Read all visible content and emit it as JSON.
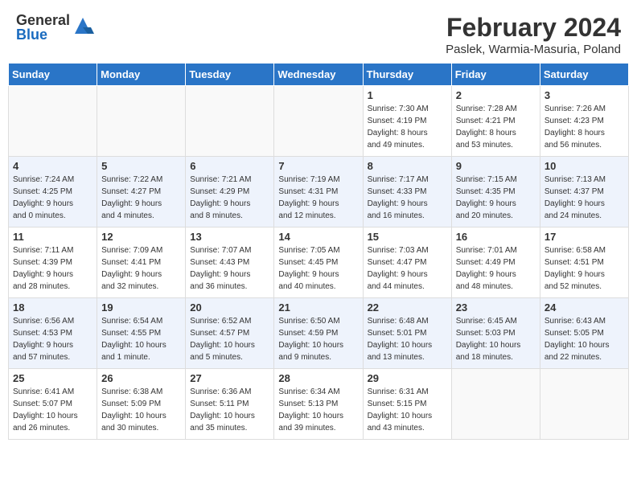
{
  "header": {
    "logo_general": "General",
    "logo_blue": "Blue",
    "month_year": "February 2024",
    "location": "Paslek, Warmia-Masuria, Poland"
  },
  "days_of_week": [
    "Sunday",
    "Monday",
    "Tuesday",
    "Wednesday",
    "Thursday",
    "Friday",
    "Saturday"
  ],
  "weeks": [
    [
      {
        "day": "",
        "info": ""
      },
      {
        "day": "",
        "info": ""
      },
      {
        "day": "",
        "info": ""
      },
      {
        "day": "",
        "info": ""
      },
      {
        "day": "1",
        "info": "Sunrise: 7:30 AM\nSunset: 4:19 PM\nDaylight: 8 hours\nand 49 minutes."
      },
      {
        "day": "2",
        "info": "Sunrise: 7:28 AM\nSunset: 4:21 PM\nDaylight: 8 hours\nand 53 minutes."
      },
      {
        "day": "3",
        "info": "Sunrise: 7:26 AM\nSunset: 4:23 PM\nDaylight: 8 hours\nand 56 minutes."
      }
    ],
    [
      {
        "day": "4",
        "info": "Sunrise: 7:24 AM\nSunset: 4:25 PM\nDaylight: 9 hours\nand 0 minutes."
      },
      {
        "day": "5",
        "info": "Sunrise: 7:22 AM\nSunset: 4:27 PM\nDaylight: 9 hours\nand 4 minutes."
      },
      {
        "day": "6",
        "info": "Sunrise: 7:21 AM\nSunset: 4:29 PM\nDaylight: 9 hours\nand 8 minutes."
      },
      {
        "day": "7",
        "info": "Sunrise: 7:19 AM\nSunset: 4:31 PM\nDaylight: 9 hours\nand 12 minutes."
      },
      {
        "day": "8",
        "info": "Sunrise: 7:17 AM\nSunset: 4:33 PM\nDaylight: 9 hours\nand 16 minutes."
      },
      {
        "day": "9",
        "info": "Sunrise: 7:15 AM\nSunset: 4:35 PM\nDaylight: 9 hours\nand 20 minutes."
      },
      {
        "day": "10",
        "info": "Sunrise: 7:13 AM\nSunset: 4:37 PM\nDaylight: 9 hours\nand 24 minutes."
      }
    ],
    [
      {
        "day": "11",
        "info": "Sunrise: 7:11 AM\nSunset: 4:39 PM\nDaylight: 9 hours\nand 28 minutes."
      },
      {
        "day": "12",
        "info": "Sunrise: 7:09 AM\nSunset: 4:41 PM\nDaylight: 9 hours\nand 32 minutes."
      },
      {
        "day": "13",
        "info": "Sunrise: 7:07 AM\nSunset: 4:43 PM\nDaylight: 9 hours\nand 36 minutes."
      },
      {
        "day": "14",
        "info": "Sunrise: 7:05 AM\nSunset: 4:45 PM\nDaylight: 9 hours\nand 40 minutes."
      },
      {
        "day": "15",
        "info": "Sunrise: 7:03 AM\nSunset: 4:47 PM\nDaylight: 9 hours\nand 44 minutes."
      },
      {
        "day": "16",
        "info": "Sunrise: 7:01 AM\nSunset: 4:49 PM\nDaylight: 9 hours\nand 48 minutes."
      },
      {
        "day": "17",
        "info": "Sunrise: 6:58 AM\nSunset: 4:51 PM\nDaylight: 9 hours\nand 52 minutes."
      }
    ],
    [
      {
        "day": "18",
        "info": "Sunrise: 6:56 AM\nSunset: 4:53 PM\nDaylight: 9 hours\nand 57 minutes."
      },
      {
        "day": "19",
        "info": "Sunrise: 6:54 AM\nSunset: 4:55 PM\nDaylight: 10 hours\nand 1 minute."
      },
      {
        "day": "20",
        "info": "Sunrise: 6:52 AM\nSunset: 4:57 PM\nDaylight: 10 hours\nand 5 minutes."
      },
      {
        "day": "21",
        "info": "Sunrise: 6:50 AM\nSunset: 4:59 PM\nDaylight: 10 hours\nand 9 minutes."
      },
      {
        "day": "22",
        "info": "Sunrise: 6:48 AM\nSunset: 5:01 PM\nDaylight: 10 hours\nand 13 minutes."
      },
      {
        "day": "23",
        "info": "Sunrise: 6:45 AM\nSunset: 5:03 PM\nDaylight: 10 hours\nand 18 minutes."
      },
      {
        "day": "24",
        "info": "Sunrise: 6:43 AM\nSunset: 5:05 PM\nDaylight: 10 hours\nand 22 minutes."
      }
    ],
    [
      {
        "day": "25",
        "info": "Sunrise: 6:41 AM\nSunset: 5:07 PM\nDaylight: 10 hours\nand 26 minutes."
      },
      {
        "day": "26",
        "info": "Sunrise: 6:38 AM\nSunset: 5:09 PM\nDaylight: 10 hours\nand 30 minutes."
      },
      {
        "day": "27",
        "info": "Sunrise: 6:36 AM\nSunset: 5:11 PM\nDaylight: 10 hours\nand 35 minutes."
      },
      {
        "day": "28",
        "info": "Sunrise: 6:34 AM\nSunset: 5:13 PM\nDaylight: 10 hours\nand 39 minutes."
      },
      {
        "day": "29",
        "info": "Sunrise: 6:31 AM\nSunset: 5:15 PM\nDaylight: 10 hours\nand 43 minutes."
      },
      {
        "day": "",
        "info": ""
      },
      {
        "day": "",
        "info": ""
      }
    ]
  ]
}
